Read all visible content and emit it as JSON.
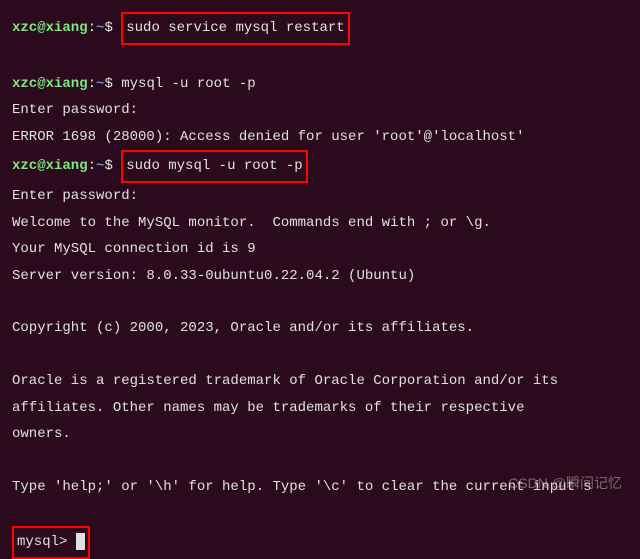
{
  "prompt": {
    "user": "xzc@xiang",
    "colon": ":",
    "tilde": "~",
    "dollar": "$ "
  },
  "lines": {
    "cmd1": "sudo service mysql restart",
    "cmd2": "mysql -u root -p",
    "enter_pw": "Enter password:",
    "error": "ERROR 1698 (28000): Access denied for user 'root'@'localhost'",
    "cmd3": "sudo mysql -u root -p",
    "welcome": "Welcome to the MySQL monitor.  Commands end with ; or \\g.",
    "conn_id": "Your MySQL connection id is 9",
    "version": "Server version: 8.0.33-0ubuntu0.22.04.2 (Ubuntu)",
    "copyright": "Copyright (c) 2000, 2023, Oracle and/or its affiliates.",
    "trademark1": "Oracle is a registered trademark of Oracle Corporation and/or its",
    "trademark2": "affiliates. Other names may be trademarks of their respective",
    "trademark3": "owners.",
    "help": "Type 'help;' or '\\h' for help. Type '\\c' to clear the current input s",
    "mysql_prompt": "mysql> "
  },
  "watermark": "CSDN @瞬间记忆"
}
